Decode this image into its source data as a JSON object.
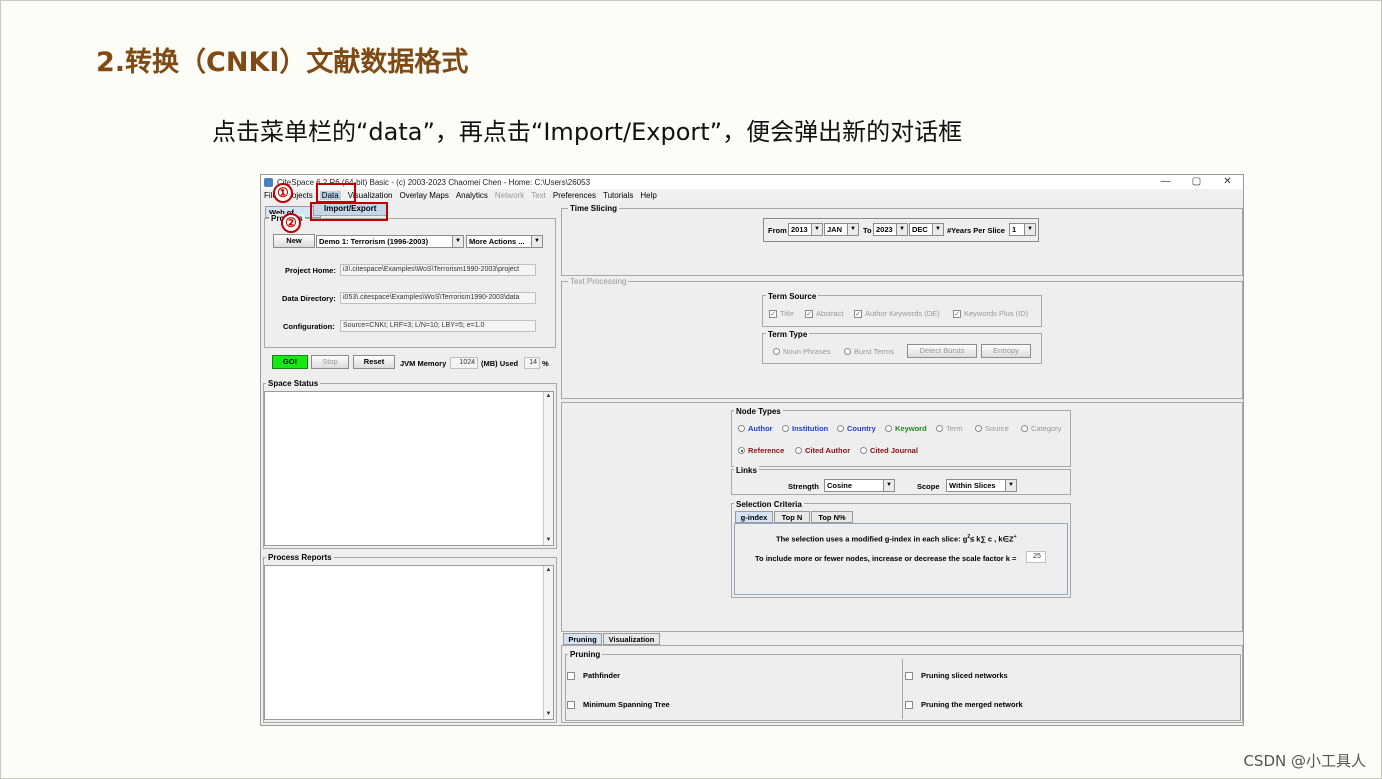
{
  "slide": {
    "heading": "2.转换（CNKI）文献数据格式",
    "instruction": "点击菜单栏的“data”，再点击“Import/Export”，便会弹出新的对话框",
    "watermark": "CSDN @小工具人"
  },
  "window": {
    "title": "CiteSpace 6.2.R6 (64-bit) Basic - (c) 2003-2023 Chaomei Chen - Home: C:\\Users\\26053",
    "controls": [
      "—",
      "▢",
      "✕"
    ]
  },
  "menu": {
    "items": [
      "File",
      "Projects",
      "Data",
      "Visualization",
      "Overlay Maps",
      "Analytics",
      "Network",
      "Text",
      "Preferences",
      "Tutorials",
      "Help"
    ],
    "dropdown_item": "Import/Export"
  },
  "callouts": {
    "step1": "①",
    "step2": "②"
  },
  "left": {
    "tab_partial": "Web of Scienc",
    "projects_title": "Projects",
    "new_button": "New",
    "project_select": "Demo 1: Terrorism (1996-2003)",
    "more_actions": "More Actions ...",
    "project_home_label": "Project Home:",
    "project_home_value": "i3\\.citespace\\Examples\\WoS\\Terrorism1990-2003\\project",
    "data_dir_label": "Data Directory:",
    "data_dir_value": "i053\\.citespace\\Examples\\WoS\\Terrorism1990-2003\\data",
    "config_label": "Configuration:",
    "config_value": "Source=CNKI; LRF=3; L/N=10; LBY=5; e=1.0",
    "go_button": "GO!",
    "stop_button": "Stop",
    "reset_button": "Reset",
    "jvm_label": "JVM Memory",
    "jvm_value": "1024",
    "mb_used_label": "(MB) Used",
    "used_value": "14",
    "percent": "%",
    "space_status_title": "Space Status",
    "process_reports_title": "Process Reports"
  },
  "time_slicing": {
    "title": "Time Slicing",
    "from_label": "From",
    "from_year": "2013",
    "from_month": "JAN",
    "to_label": "To",
    "to_year": "2023",
    "to_month": "DEC",
    "years_per_slice_label": "#Years Per Slice",
    "years_per_slice": "1"
  },
  "text_processing": {
    "title": "Text Processing",
    "term_source_title": "Term Source",
    "sources": [
      "Title",
      "Abstract",
      "Author Keywords (DE)",
      "Keywords Plus (ID)"
    ],
    "term_type_title": "Term Type",
    "noun_phrases": "Noun Phrases",
    "burst_terms": "Burst Terms",
    "detect_bursts": "Detect Bursts",
    "entropy": "Entropy"
  },
  "node_types": {
    "title": "Node Types",
    "row1": [
      {
        "label": "Author",
        "color": "#1a3fd0"
      },
      {
        "label": "Institution",
        "color": "#1a3fd0"
      },
      {
        "label": "Country",
        "color": "#1a3fd0"
      },
      {
        "label": "Keyword",
        "color": "#1e8a1e"
      },
      {
        "label": "Term",
        "color": "#999999"
      },
      {
        "label": "Source",
        "color": "#999999"
      },
      {
        "label": "Category",
        "color": "#999999"
      }
    ],
    "row2": [
      {
        "label": "Reference",
        "color": "#8b1010"
      },
      {
        "label": "Cited Author",
        "color": "#8b1010"
      },
      {
        "label": "Cited Journal",
        "color": "#8b1010"
      }
    ]
  },
  "links": {
    "title": "Links",
    "strength_label": "Strength",
    "strength_value": "Cosine",
    "scope_label": "Scope",
    "scope_value": "Within Slices"
  },
  "selection": {
    "title": "Selection Criteria",
    "tabs": [
      "g-index",
      "Top N",
      "Top N%"
    ],
    "line1_prefix": "The selection uses a modified g-index in each slice: g",
    "line1_formula": "≤ k∑ c , k∈Z",
    "line2": "To include more or fewer nodes, increase or decrease the scale factor k =",
    "k_value": "25"
  },
  "bottom": {
    "tabs": [
      "Pruning",
      "Visualization"
    ],
    "pruning_title": "Pruning",
    "options": [
      "Pathfinder",
      "Pruning sliced networks",
      "Minimum Spanning Tree",
      "Pruning the merged network"
    ]
  }
}
